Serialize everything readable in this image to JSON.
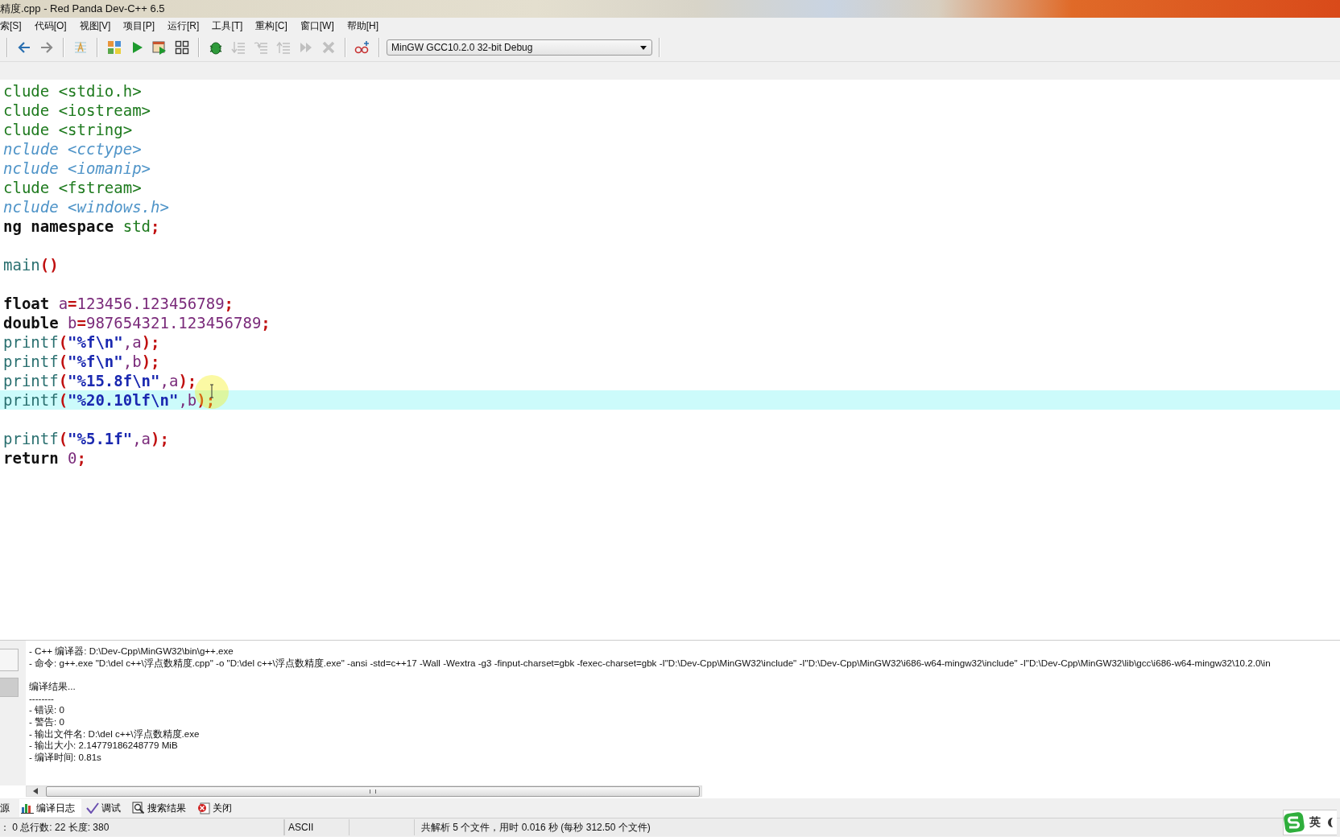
{
  "window": {
    "title": "精度.cpp - Red Panda Dev-C++ 6.5"
  },
  "menu": [
    "索[S]",
    "代码[O]",
    "视图[V]",
    "项目[P]",
    "运行[R]",
    "工具[T]",
    "重构[C]",
    "窗口[W]",
    "帮助[H]"
  ],
  "toolbar": [
    [
      {
        "kind": "back",
        "disabled": false
      },
      {
        "kind": "forward",
        "disabled": false
      }
    ],
    [
      {
        "kind": "text",
        "disabled": false
      }
    ],
    [
      {
        "kind": "tiles",
        "disabled": false
      },
      {
        "kind": "run",
        "disabled": false
      },
      {
        "kind": "runwin",
        "disabled": false
      },
      {
        "kind": "grid",
        "disabled": false
      }
    ],
    [
      {
        "kind": "debug",
        "disabled": false
      },
      {
        "kind": "stepinto",
        "disabled": true
      },
      {
        "kind": "stepover",
        "disabled": true
      },
      {
        "kind": "stepout",
        "disabled": true
      },
      {
        "kind": "continue",
        "disabled": true
      },
      {
        "kind": "stop",
        "disabled": true
      }
    ],
    [
      {
        "kind": "watch",
        "disabled": false
      }
    ]
  ],
  "compiler": {
    "value": "MinGW GCC10.2.0 32-bit Debug"
  },
  "code": [
    {
      "current": false,
      "tokens": [
        {
          "kind": "pre",
          "text": "clude <stdio.h>"
        }
      ]
    },
    {
      "current": false,
      "tokens": [
        {
          "kind": "pre",
          "text": "clude <iostream>"
        }
      ]
    },
    {
      "current": false,
      "tokens": [
        {
          "kind": "pre",
          "text": "clude <string>"
        }
      ]
    },
    {
      "current": false,
      "tokens": [
        {
          "kind": "off",
          "text": "nclude <cctype>"
        }
      ]
    },
    {
      "current": false,
      "tokens": [
        {
          "kind": "off",
          "text": "nclude <iomanip>"
        }
      ]
    },
    {
      "current": false,
      "tokens": [
        {
          "kind": "pre",
          "text": "clude <fstream>"
        }
      ]
    },
    {
      "current": false,
      "tokens": [
        {
          "kind": "off",
          "text": "nclude <windows.h>"
        }
      ]
    },
    {
      "current": false,
      "tokens": [
        {
          "kind": "kw",
          "text": "ng namespace "
        },
        {
          "kind": "pre",
          "text": "std"
        },
        {
          "kind": "punct",
          "text": ";"
        }
      ]
    },
    {
      "current": false
    },
    {
      "current": false,
      "tokens": [
        {
          "kind": "fn",
          "text": "main"
        },
        {
          "kind": "punct",
          "text": "()"
        }
      ]
    },
    {
      "current": false
    },
    {
      "current": false,
      "tokens": [
        {
          "kind": "kw",
          "text": "float "
        },
        {
          "kind": "var",
          "text": "a"
        },
        {
          "kind": "punct",
          "text": "="
        },
        {
          "kind": "num",
          "text": "123456.123456789"
        },
        {
          "kind": "punct",
          "text": ";"
        }
      ]
    },
    {
      "current": false,
      "tokens": [
        {
          "kind": "kw",
          "text": "double "
        },
        {
          "kind": "var",
          "text": "b"
        },
        {
          "kind": "punct",
          "text": "="
        },
        {
          "kind": "num",
          "text": "987654321.123456789"
        },
        {
          "kind": "punct",
          "text": ";"
        }
      ]
    },
    {
      "current": false,
      "tokens": [
        {
          "kind": "fn",
          "text": "printf"
        },
        {
          "kind": "punct",
          "text": "("
        },
        {
          "kind": "str",
          "text": "\"%f\\n\""
        },
        {
          "kind": "var",
          "text": ",a"
        },
        {
          "kind": "punct",
          "text": ");"
        }
      ]
    },
    {
      "current": false,
      "tokens": [
        {
          "kind": "fn",
          "text": "printf"
        },
        {
          "kind": "punct",
          "text": "("
        },
        {
          "kind": "str",
          "text": "\"%f\\n\""
        },
        {
          "kind": "var",
          "text": ",b"
        },
        {
          "kind": "punct",
          "text": ");"
        }
      ]
    },
    {
      "current": false,
      "tokens": [
        {
          "kind": "fn",
          "text": "printf"
        },
        {
          "kind": "punct",
          "text": "("
        },
        {
          "kind": "str",
          "text": "\"%15.8f\\n\""
        },
        {
          "kind": "var",
          "text": ",a"
        },
        {
          "kind": "punct",
          "text": ");"
        }
      ]
    },
    {
      "current": true,
      "tokens": [
        {
          "kind": "fn",
          "text": "printf"
        },
        {
          "kind": "punct",
          "text": "("
        },
        {
          "kind": "str",
          "text": "\"%20.10lf\\n\""
        },
        {
          "kind": "var",
          "text": ",b"
        },
        {
          "kind": "punct",
          "text": ");"
        }
      ]
    },
    {
      "current": false
    },
    {
      "current": false,
      "tokens": [
        {
          "kind": "fn",
          "text": "printf"
        },
        {
          "kind": "punct",
          "text": "("
        },
        {
          "kind": "str",
          "text": "\"%5.1f\""
        },
        {
          "kind": "var",
          "text": ",a"
        },
        {
          "kind": "punct",
          "text": ");"
        }
      ]
    },
    {
      "current": false,
      "tokens": [
        {
          "kind": "kw",
          "text": "return "
        },
        {
          "kind": "num",
          "text": "0"
        },
        {
          "kind": "punct",
          "text": ";"
        }
      ]
    }
  ],
  "log": [
    [
      "- C++ 编译器: D:\\Dev-Cpp\\MinGW32\\bin\\g++.exe",
      "- 命令: g++.exe \"D:\\del c++\\浮点数精度.cpp\" -o \"D:\\del c++\\浮点数精度.exe\" -ansi -std=c++17 -Wall -Wextra -g3 -finput-charset=gbk -fexec-charset=gbk -I\"D:\\Dev-Cpp\\MinGW32\\include\" -I\"D:\\Dev-Cpp\\MinGW32\\i686-w64-mingw32\\include\" -I\"D:\\Dev-Cpp\\MinGW32\\lib\\gcc\\i686-w64-mingw32\\10.2.0\\in"
    ],
    [
      "编译结果...",
      "--------",
      "- 错误: 0",
      "- 警告: 0",
      "- 输出文件名: D:\\del c++\\浮点数精度.exe",
      "- 输出大小: 2.14779186248779 MiB",
      "- 编译时间: 0.81s"
    ]
  ],
  "bottom_tabs": [
    {
      "label": "源",
      "kind": "none",
      "selected": false
    },
    {
      "label": "编译日志",
      "kind": "chart",
      "selected": true
    },
    {
      "label": "调试",
      "kind": "check",
      "selected": false
    },
    {
      "label": "搜索结果",
      "kind": "search",
      "selected": false
    },
    {
      "label": "关闭",
      "kind": "close",
      "selected": false
    }
  ],
  "status_bar": {
    "position": "：  0  总行数:  22  长度:  380",
    "encoding": "ASCII",
    "parse_info": "共解析 5 个文件，用时 0.016 秒 (每秒 312.50 个文件)"
  },
  "ime": {
    "label": "英"
  }
}
